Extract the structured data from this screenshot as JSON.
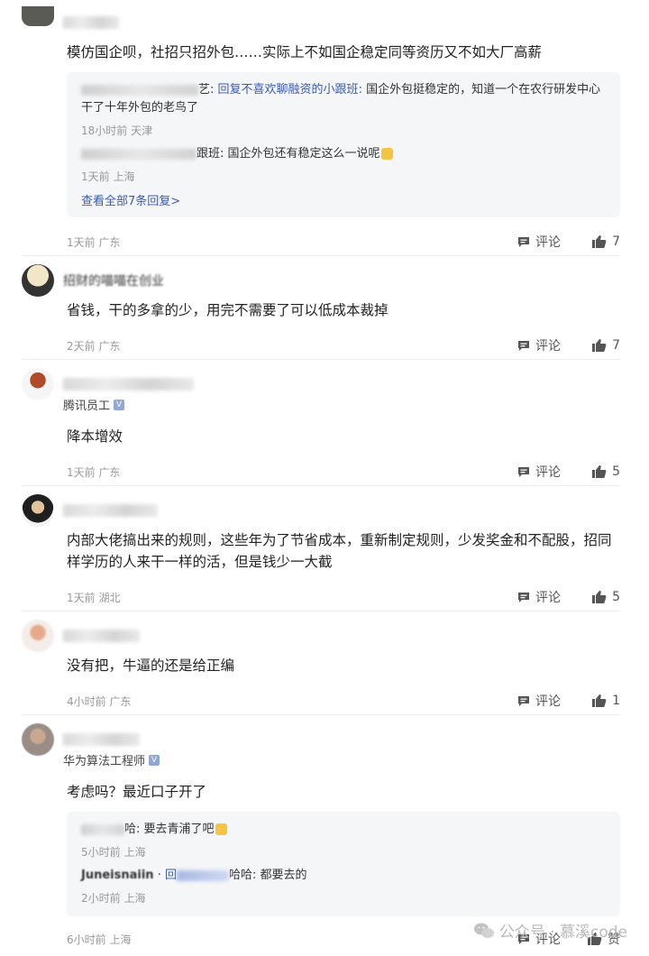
{
  "comments": [
    {
      "text": "模仿国企呗，社招只招外包……实际上不如国企稳定同等资历又不如大厂高薪",
      "replies": [
        {
          "name_tail": "艺:",
          "reply_label": "回复",
          "reply_to": "不喜欢聊融资的小跟班",
          "text": "国企外包挺稳定的，知道一个在农行研发中心干了十年外包的老鸟了",
          "time": "18小时前",
          "location": "天津"
        },
        {
          "name_tail": "跟班:",
          "text": "国企外包还有稳定这么一说呢",
          "time": "1天前",
          "location": "上海"
        }
      ],
      "view_all": "查看全部7条回复>",
      "time": "1天前",
      "location": "广东",
      "comment_label": "评论",
      "likes": "7"
    },
    {
      "name": "招财的喵喵在创业",
      "text": "省钱，干的多拿的少，用完不需要了可以低成本裁掉",
      "time": "2天前",
      "location": "广东",
      "comment_label": "评论",
      "likes": "7"
    },
    {
      "tag": "腾讯员工",
      "text": "降本增效",
      "time": "1天前",
      "location": "广东",
      "comment_label": "评论",
      "likes": "5"
    },
    {
      "text": "内部大佬搞出来的规则，这些年为了节省成本，重新制定规则，少发奖金和不配股，招同样学历的人来干一样的活，但是钱少一大截",
      "time": "1天前",
      "location": "湖北",
      "comment_label": "评论",
      "likes": "5"
    },
    {
      "text": "没有把，牛逼的还是给正编",
      "time": "4小时前",
      "location": "广东",
      "comment_label": "评论",
      "likes": "1"
    },
    {
      "tag": "华为算法工程师",
      "text": "考虑吗？最近口子开了",
      "replies": [
        {
          "name_tail": "哈:",
          "text": "要去青浦了吧",
          "time": "5小时前",
          "location": "上海"
        },
        {
          "name": "Juneisnaiin",
          "reply_label": "回",
          "name_tail": "哈哈:",
          "text": "都要去的",
          "time": "2小时前",
          "location": "上海"
        }
      ],
      "time": "6小时前",
      "location": "上海",
      "comment_label": "评论",
      "likes": "赞"
    }
  ],
  "watermark": {
    "text": "公众号 · 慕溪code",
    "icon": "wechat-icon"
  },
  "colors": {
    "link": "#3b5bb5",
    "meta": "#999999",
    "reply_bg": "#f5f6f8"
  }
}
